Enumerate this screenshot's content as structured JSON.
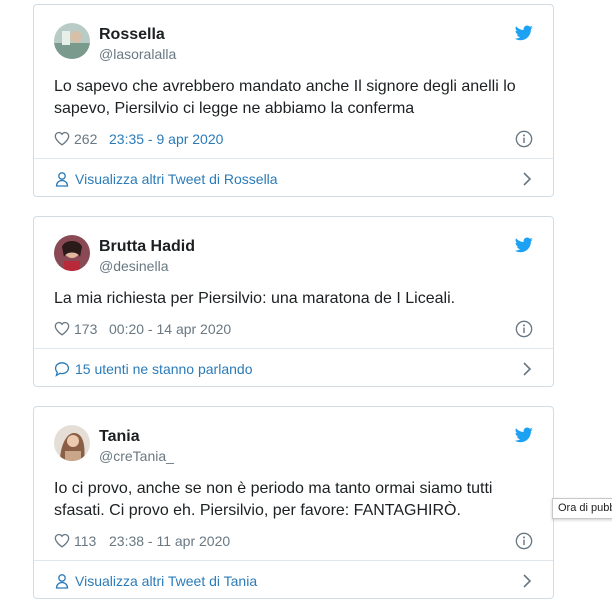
{
  "tweets": [
    {
      "name": "Rossella",
      "handle": "@lasoralalla",
      "text_lines": [
        "Lo sapevo che avrebbero mandato anche Il signore degli anelli lo",
        "sapevo, Piersilvio ci legge ne abbiamo la conferma"
      ],
      "likes": "262",
      "time": "23:35 - 9 apr 2020",
      "footer": "Visualizza altri Tweet di Rossella",
      "footer_icon": "person-icon",
      "avatar_color": "#7a9a8e"
    },
    {
      "name": "Brutta Hadid",
      "handle": "@desinella",
      "text_lines": [
        "La mia richiesta per Piersilvio: una maratona de I Liceali."
      ],
      "likes": "173",
      "time": "00:20 - 14 apr 2020",
      "footer": "15 utenti ne stanno parlando",
      "footer_icon": "speech-bubble-icon",
      "avatar_color": "#6b2a3a"
    },
    {
      "name": "Tania",
      "handle": "@creTania_",
      "text_lines": [
        "Io ci provo, anche se non è periodo ma tanto ormai siamo tutti",
        "sfasati. Ci provo eh. Piersilvio, per favore: FANTAGHIRÒ."
      ],
      "likes": "113",
      "time": "23:38 - 11 apr 2020",
      "footer": "Visualizza altri Tweet di Tania",
      "footer_icon": "person-icon",
      "avatar_color": "#c9a58a"
    }
  ],
  "tooltip": "Ora di pubblicazione",
  "colors": {
    "twitter_blue": "#1da1f2",
    "link_blue": "#2b7bb9",
    "muted": "#697882",
    "border": "#d3dce3"
  }
}
